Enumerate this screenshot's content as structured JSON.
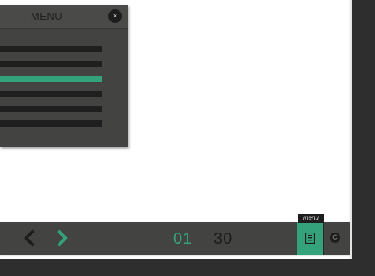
{
  "menu": {
    "title": "MENU",
    "close_label": "×",
    "items": [
      {
        "active": false
      },
      {
        "active": false
      },
      {
        "active": true
      },
      {
        "active": false
      },
      {
        "active": false
      },
      {
        "active": false
      }
    ]
  },
  "toolbar": {
    "prev_icon": "chevron-left-icon",
    "next_icon": "chevron-right-icon",
    "page_current": "01",
    "page_total": "30",
    "menu_tooltip": "menu",
    "menu_icon": "document-icon",
    "copyright_glyph": "C"
  },
  "colors": {
    "accent": "#34a37c",
    "panel": "#434341",
    "frame": "#2e2e2e",
    "dark": "#1d1d1d"
  }
}
